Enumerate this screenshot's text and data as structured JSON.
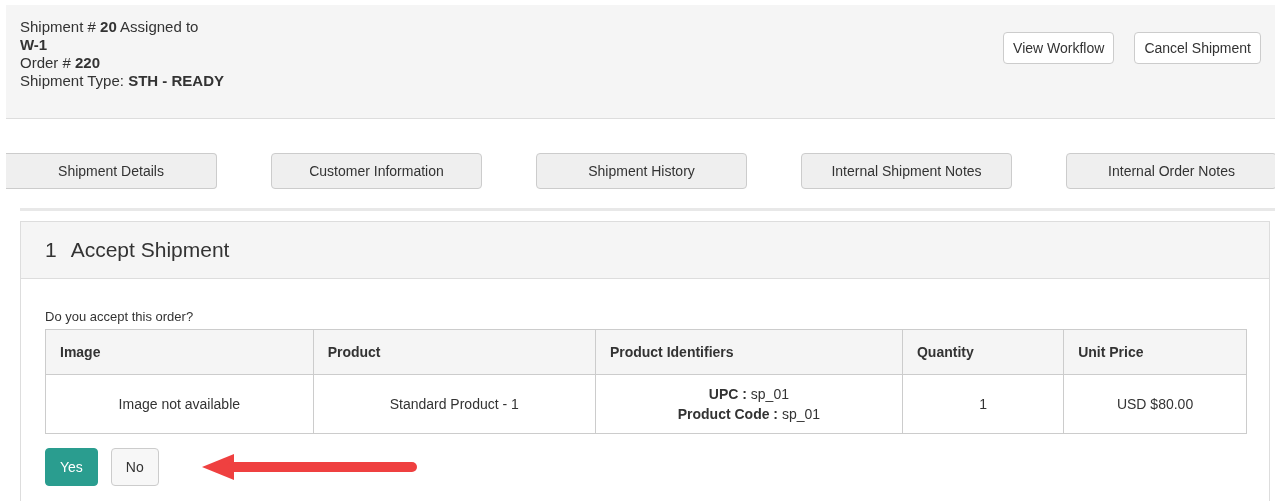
{
  "header": {
    "lines": [
      "Shipment # **20** Assigned to",
      "**W-1**",
      "Order # **220**",
      "Shipment Type: **STH - READY**"
    ],
    "buttons": [
      "View Workflow",
      "Cancel Shipment"
    ]
  },
  "tabs": [
    "Shipment Details",
    "Customer Information",
    "Shipment History",
    "Internal Shipment Notes",
    "Internal Order Notes"
  ],
  "step": {
    "number": "1",
    "title": "Accept Shipment",
    "question": "Do you accept this order?",
    "table": {
      "columns": [
        "Image",
        "Product",
        "Product Identifiers",
        "Quantity",
        "Unit Price"
      ],
      "rows": [
        {
          "cells": [
            [
              "Image not available"
            ],
            [
              "Standard Product - 1"
            ],
            [
              "**UPC :** sp_01",
              "**Product Code :** sp_01"
            ],
            [
              "1"
            ],
            [
              "USD $80.00"
            ]
          ]
        }
      ]
    },
    "buttons": [
      {
        "label": "Yes",
        "kind": "primary"
      },
      {
        "label": "No",
        "kind": "default"
      }
    ]
  }
}
